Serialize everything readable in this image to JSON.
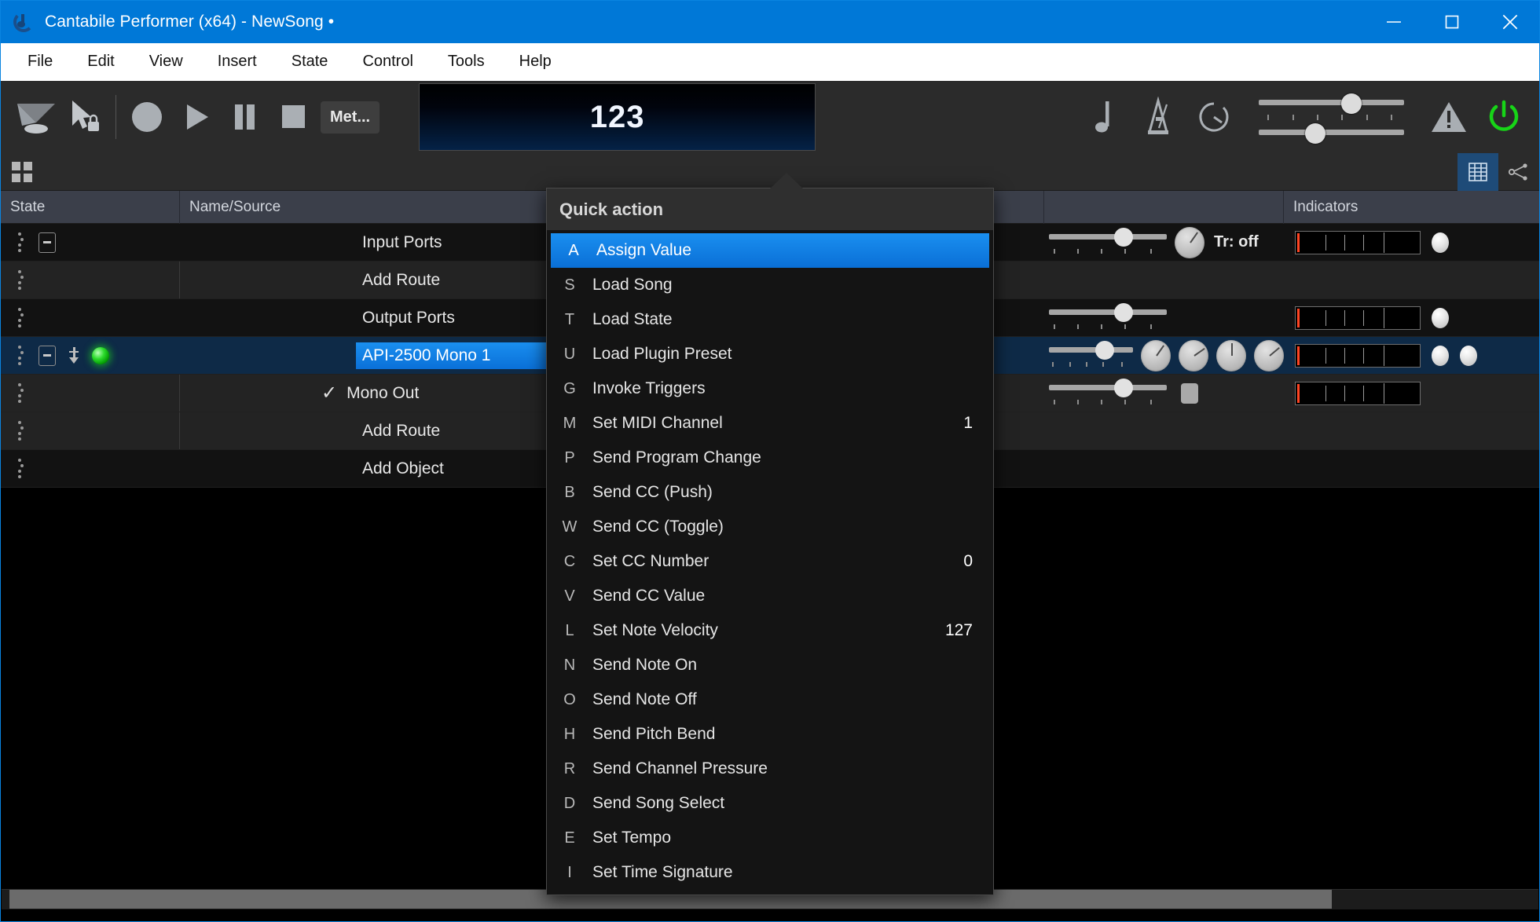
{
  "window": {
    "title": "Cantabile Performer (x64) - NewSong •",
    "icon": "cantabile-logo-icon",
    "controls": {
      "minimize": "minimize-icon",
      "maximize": "maximize-icon",
      "close": "close-icon"
    }
  },
  "menubar": {
    "items": [
      "File",
      "Edit",
      "View",
      "Insert",
      "State",
      "Control",
      "Tools",
      "Help"
    ]
  },
  "toolbar": {
    "icons": [
      "monitor-icon",
      "pointer-lock-icon",
      "record-icon",
      "play-icon",
      "pause-icon",
      "stop-icon"
    ],
    "metronome_button": "Met...",
    "tempo_value": "123",
    "right_icons": [
      "quarter-note-icon",
      "metronome-icon",
      "stopwatch-icon"
    ],
    "warning_icon": "warning-triangle-icon",
    "power_icon": "power-icon",
    "power_color": "#17d417",
    "slider_top_percent": 57,
    "slider_bottom_percent": 32
  },
  "strip": {
    "grid_icon": "grid-view-icon",
    "buttons": [
      {
        "name": "table-view-icon",
        "active": true
      },
      {
        "name": "routing-graph-icon",
        "active": false
      }
    ]
  },
  "table": {
    "columns": [
      "State",
      "Name/Source",
      "",
      "Indicators"
    ],
    "rows": [
      {
        "name": "Input Ports",
        "indent": 0,
        "has_expander": true,
        "has_arrow": false,
        "has_led": false,
        "checked": false,
        "selected": false,
        "shade": "dark",
        "slider": 55,
        "knobs": 0,
        "knob_angles": [],
        "meter": true,
        "bulbs": 1,
        "small_square": false,
        "transpose_label": "Tr: off"
      },
      {
        "name": "Add Route",
        "indent": 1,
        "has_expander": false,
        "has_arrow": false,
        "has_led": false,
        "checked": false,
        "selected": false,
        "shade": "mid",
        "slider": null,
        "knobs": 0,
        "knob_angles": [],
        "meter": false,
        "bulbs": 0,
        "small_square": false,
        "transpose_label": ""
      },
      {
        "name": "Output Ports",
        "indent": 0,
        "has_expander": false,
        "has_arrow": false,
        "has_led": false,
        "checked": false,
        "selected": false,
        "shade": "dark",
        "slider": 55,
        "knobs": 0,
        "knob_angles": [],
        "meter": true,
        "bulbs": 1,
        "small_square": false,
        "transpose_label": ""
      },
      {
        "name": "API-2500 Mono 1",
        "indent": 0,
        "has_expander": true,
        "has_arrow": true,
        "has_led": true,
        "checked": false,
        "selected": true,
        "shade": "sel",
        "slider": 55,
        "knobs": 4,
        "knob_angles": [
          215,
          235,
          180,
          230
        ],
        "meter": true,
        "bulbs": 2,
        "small_square": false,
        "transpose_label": ""
      },
      {
        "name": "Mono Out",
        "indent": 1,
        "has_expander": false,
        "has_arrow": false,
        "has_led": false,
        "checked": true,
        "selected": false,
        "shade": "mid",
        "slider": 55,
        "knobs": 0,
        "knob_angles": [],
        "meter": true,
        "bulbs": 0,
        "small_square": true,
        "transpose_label": ""
      },
      {
        "name": "Add Route",
        "indent": 1,
        "has_expander": false,
        "has_arrow": false,
        "has_led": false,
        "checked": false,
        "selected": false,
        "shade": "mid",
        "slider": null,
        "knobs": 0,
        "knob_angles": [],
        "meter": false,
        "bulbs": 0,
        "small_square": false,
        "transpose_label": ""
      },
      {
        "name": "Add Object",
        "indent": 0,
        "has_expander": false,
        "has_arrow": false,
        "has_led": false,
        "checked": false,
        "selected": false,
        "shade": "dark",
        "slider": null,
        "knobs": 0,
        "knob_angles": [],
        "meter": false,
        "bulbs": 0,
        "small_square": false,
        "transpose_label": ""
      }
    ]
  },
  "popup": {
    "title": "Quick action",
    "items": [
      {
        "key": "A",
        "label": "Assign Value",
        "value": "",
        "selected": true
      },
      {
        "key": "S",
        "label": "Load Song",
        "value": "",
        "selected": false
      },
      {
        "key": "T",
        "label": "Load State",
        "value": "",
        "selected": false
      },
      {
        "key": "U",
        "label": "Load Plugin Preset",
        "value": "",
        "selected": false
      },
      {
        "key": "G",
        "label": "Invoke Triggers",
        "value": "",
        "selected": false
      },
      {
        "key": "M",
        "label": "Set MIDI Channel",
        "value": "1",
        "selected": false
      },
      {
        "key": "P",
        "label": "Send Program Change",
        "value": "",
        "selected": false
      },
      {
        "key": "B",
        "label": "Send CC (Push)",
        "value": "",
        "selected": false
      },
      {
        "key": "W",
        "label": "Send CC (Toggle)",
        "value": "",
        "selected": false
      },
      {
        "key": "C",
        "label": "Set CC Number",
        "value": "0",
        "selected": false
      },
      {
        "key": "V",
        "label": "Send CC Value",
        "value": "",
        "selected": false
      },
      {
        "key": "L",
        "label": "Set Note Velocity",
        "value": "127",
        "selected": false
      },
      {
        "key": "N",
        "label": "Send Note On",
        "value": "",
        "selected": false
      },
      {
        "key": "O",
        "label": "Send Note Off",
        "value": "",
        "selected": false
      },
      {
        "key": "H",
        "label": "Send Pitch Bend",
        "value": "",
        "selected": false
      },
      {
        "key": "R",
        "label": "Send Channel Pressure",
        "value": "",
        "selected": false
      },
      {
        "key": "D",
        "label": "Send Song Select",
        "value": "",
        "selected": false
      },
      {
        "key": "E",
        "label": "Set Tempo",
        "value": "",
        "selected": false
      },
      {
        "key": "I",
        "label": "Set Time Signature",
        "value": "",
        "selected": false
      }
    ]
  },
  "scrollbar": {
    "name": "horizontal-scrollbar",
    "thumb_percent": 87
  },
  "colors": {
    "titlebar": "#0078d7",
    "accent": "#0a8ff0",
    "selection": "#0e2a47",
    "led_green": "#2ddb2d",
    "meter_red": "#ff4422"
  }
}
